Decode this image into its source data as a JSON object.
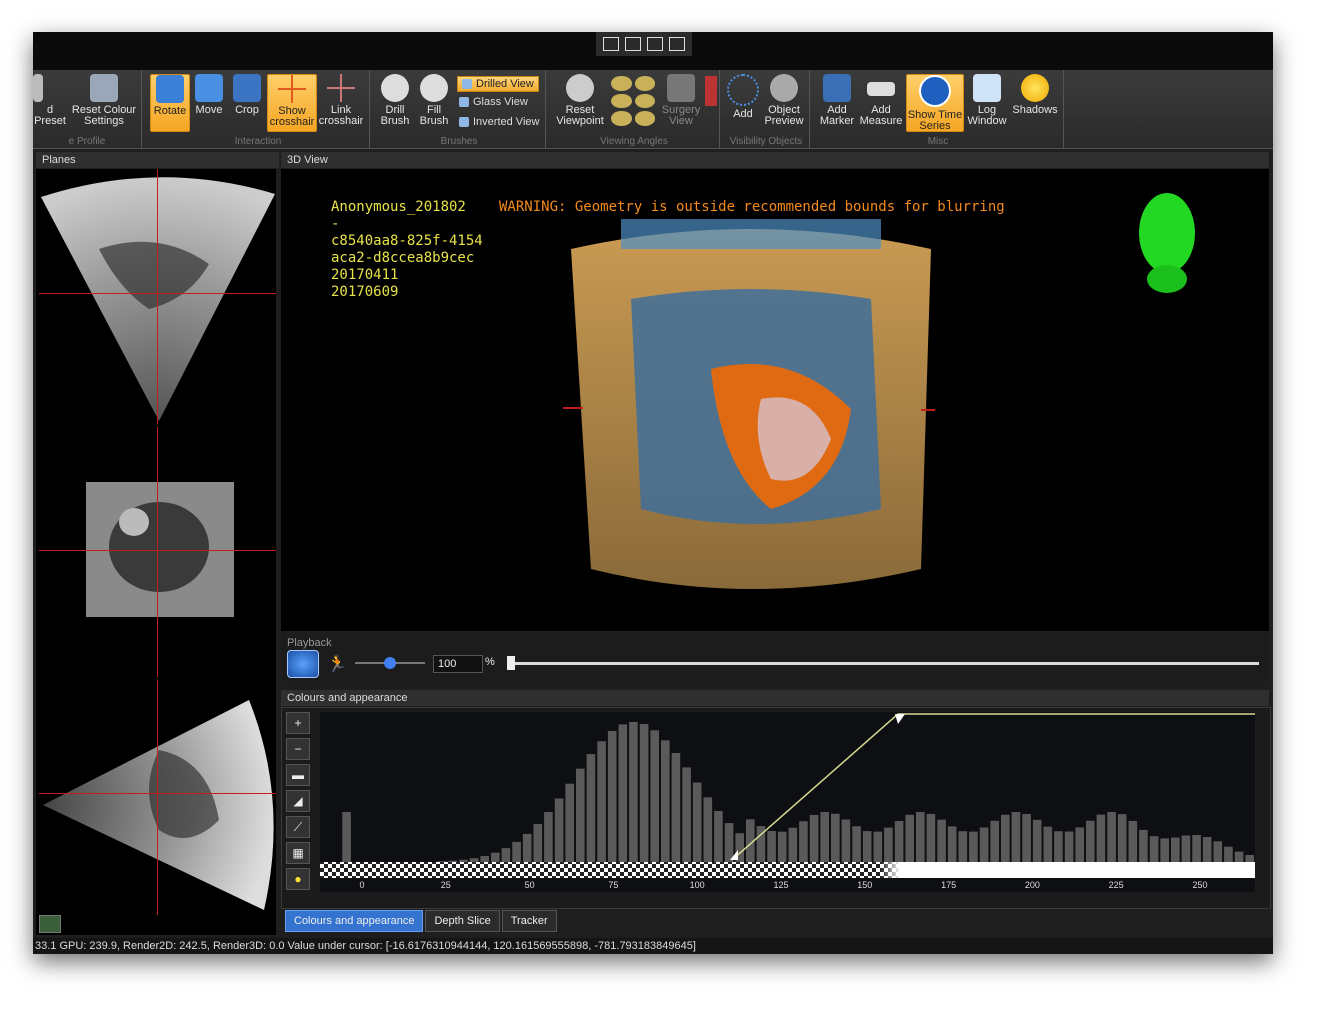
{
  "ribbon": {
    "profile_group": {
      "label": "e Profile",
      "buttons": [
        "d",
        "Preset",
        "Reset Colour",
        "Settings"
      ]
    },
    "interaction_group": {
      "label": "Interaction",
      "buttons": [
        {
          "label": "Rotate",
          "active": true
        },
        {
          "label": "Move",
          "active": false
        },
        {
          "label": "Crop",
          "active": false
        },
        {
          "label": "Show crosshair",
          "active": true
        },
        {
          "label": "Link crosshair",
          "active": false
        }
      ]
    },
    "brushes_group": {
      "label": "Brushes",
      "buttons": [
        "Drill Brush",
        "Fill Brush"
      ],
      "options": [
        {
          "label": "Drilled View",
          "active": true
        },
        {
          "label": "Glass View",
          "active": false
        },
        {
          "label": "Inverted View",
          "active": false
        }
      ]
    },
    "viewing_group": {
      "label": "Viewing Angles",
      "buttons": [
        "Reset Viewpoint",
        "Surgery View"
      ]
    },
    "visibility_group": {
      "label": "Visibility Objects",
      "buttons": [
        "Add",
        "Object Preview"
      ]
    },
    "misc_group": {
      "label": "Misc",
      "buttons": [
        {
          "label": "Add Marker",
          "active": false
        },
        {
          "label": "Add Measure",
          "active": false
        },
        {
          "label": "Show Time Series",
          "active": true
        },
        {
          "label": "Log Window",
          "active": false
        },
        {
          "label": "Shadows",
          "active": false
        }
      ]
    }
  },
  "planes": {
    "title": "Planes"
  },
  "view3d": {
    "title": "3D View",
    "info_lines": [
      "Anonymous_201802",
      "-",
      "c8540aa8-825f-4154",
      "aca2-d8ccea8b9cec",
      "20170411",
      "20170609"
    ],
    "warning": "WARNING: Geometry is outside recommended bounds for blurring"
  },
  "playback": {
    "title": "Playback",
    "speed_value": "100",
    "unit": "%",
    "speed_level": 0.5
  },
  "colours": {
    "title": "Colours and appearance",
    "x_ticks": [
      "0",
      "25",
      "50",
      "75",
      "100",
      "125",
      "150",
      "175",
      "200",
      "225",
      "250"
    ]
  },
  "tabs": [
    {
      "label": "Colours and appearance",
      "active": true
    },
    {
      "label": "Depth Slice",
      "active": false
    },
    {
      "label": "Tracker",
      "active": false
    }
  ],
  "status": {
    "text": "33.1 GPU: 239.9, Render2D: 242.5, Render3D: 0.0  Value under cursor: [-16.6176310944144, 120.161569555898, -781.793183849645]"
  },
  "colors": {
    "accent": "#f5a623",
    "warning": "#f28a1e",
    "overlay_text": "#e8e24a",
    "crosshair": "#c0201c",
    "tab_active": "#3474d0"
  }
}
